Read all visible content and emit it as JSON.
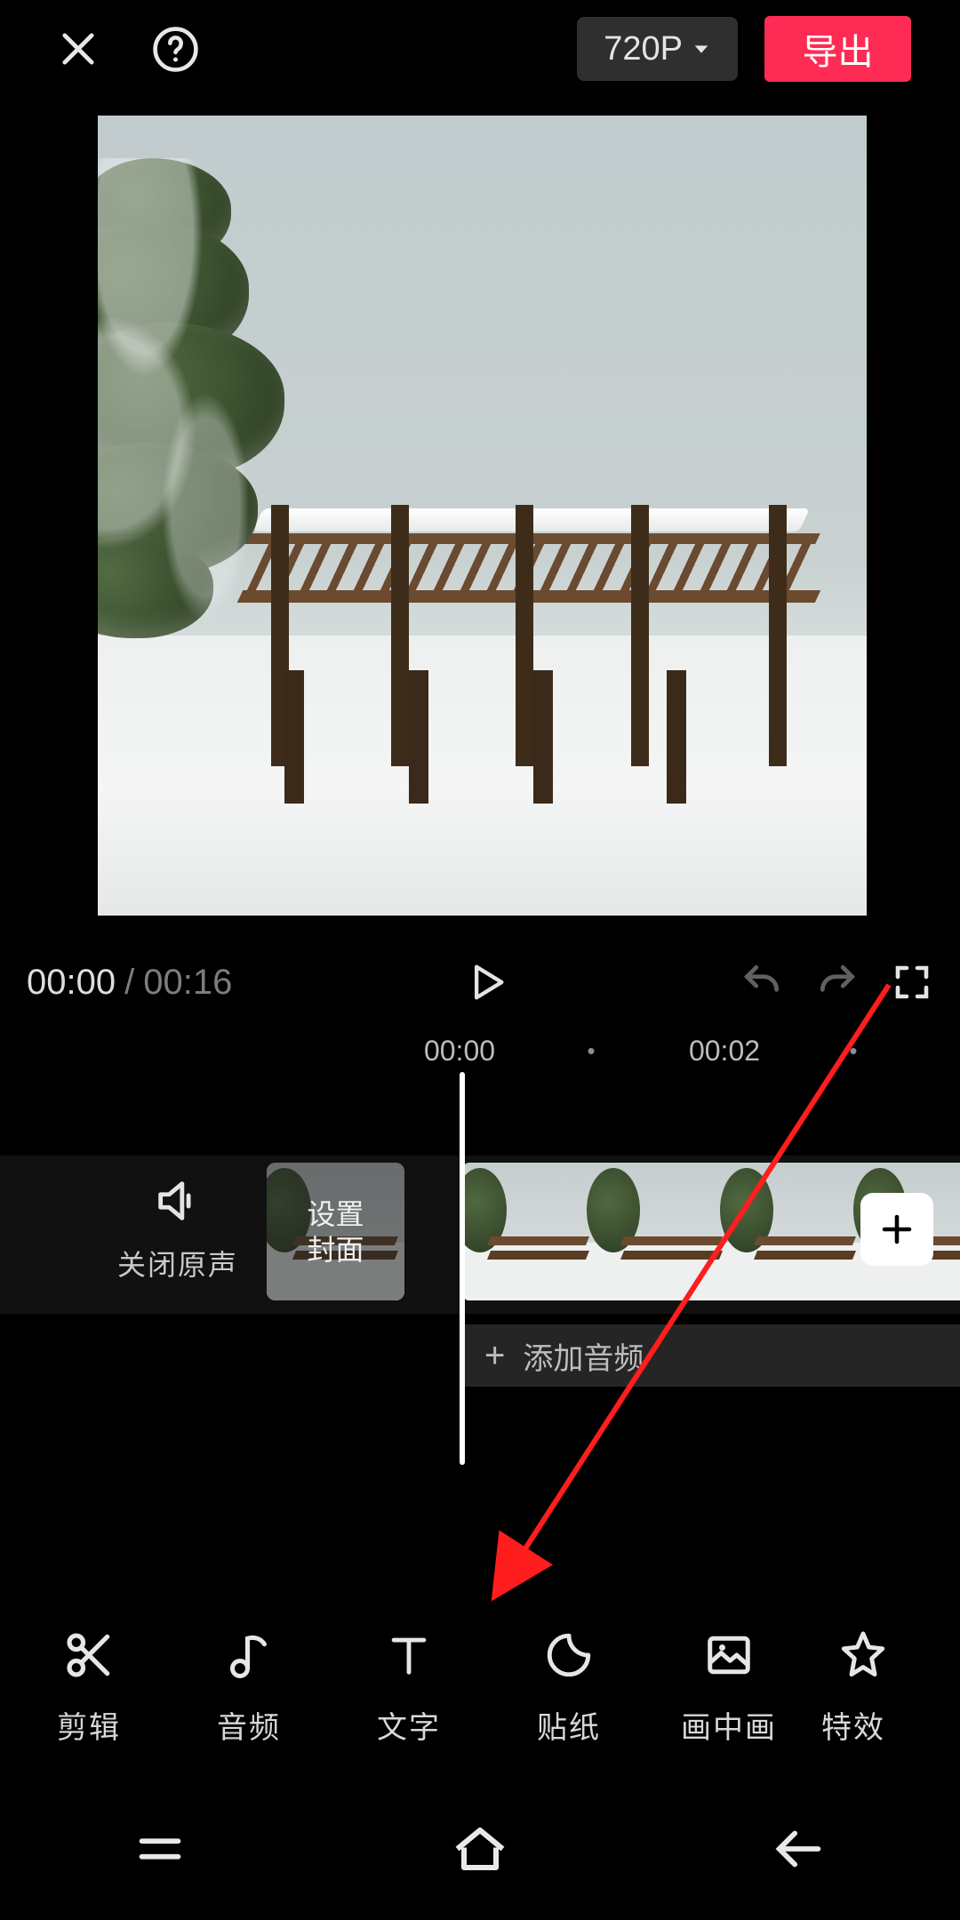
{
  "header": {
    "resolution_label": "720P",
    "export_label": "导出"
  },
  "playback": {
    "current_time": "00:00",
    "separator": "/",
    "duration": "00:16"
  },
  "ruler": {
    "ticks": [
      "00:00",
      "00:02"
    ]
  },
  "mute": {
    "label": "关闭原声"
  },
  "cover": {
    "line1": "设置",
    "line2": "封面"
  },
  "audio_add": {
    "plus": "+",
    "label": "添加音频"
  },
  "tools": [
    {
      "id": "edit",
      "label": "剪辑"
    },
    {
      "id": "audio",
      "label": "音频"
    },
    {
      "id": "text",
      "label": "文字"
    },
    {
      "id": "sticker",
      "label": "贴纸"
    },
    {
      "id": "pip",
      "label": "画中画"
    },
    {
      "id": "fx",
      "label": "特效"
    }
  ],
  "add_chip": "+"
}
